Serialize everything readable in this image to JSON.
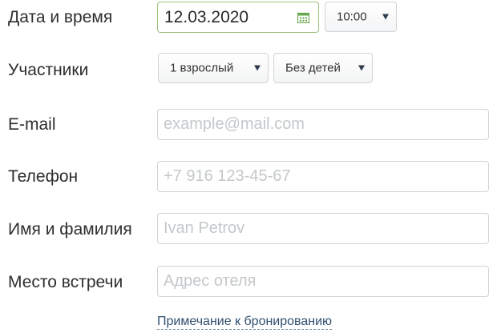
{
  "labels": {
    "date_time": "Дата и время",
    "participants": "Участники",
    "email": "E-mail",
    "phone": "Телефон",
    "name": "Имя и фамилия",
    "meeting_place": "Место встречи"
  },
  "date": {
    "value": "12.03.2020",
    "icon": "calendar-icon"
  },
  "time": {
    "value": "10:00"
  },
  "adults": {
    "value": "1 взрослый"
  },
  "children": {
    "value": "Без детей"
  },
  "email_field": {
    "value": "",
    "placeholder": "example@mail.com"
  },
  "phone_field": {
    "value": "",
    "placeholder": "+7 916 123-45-67"
  },
  "name_field": {
    "value": "",
    "placeholder": "Ivan Petrov"
  },
  "place_field": {
    "value": "",
    "placeholder": "Адрес отеля"
  },
  "note_link": "Примечание к бронированию",
  "colors": {
    "active_border": "#9bc27a",
    "calendar_icon": "#6aa84f",
    "caret": "#2f3d4c",
    "link": "#2f4f6f"
  }
}
